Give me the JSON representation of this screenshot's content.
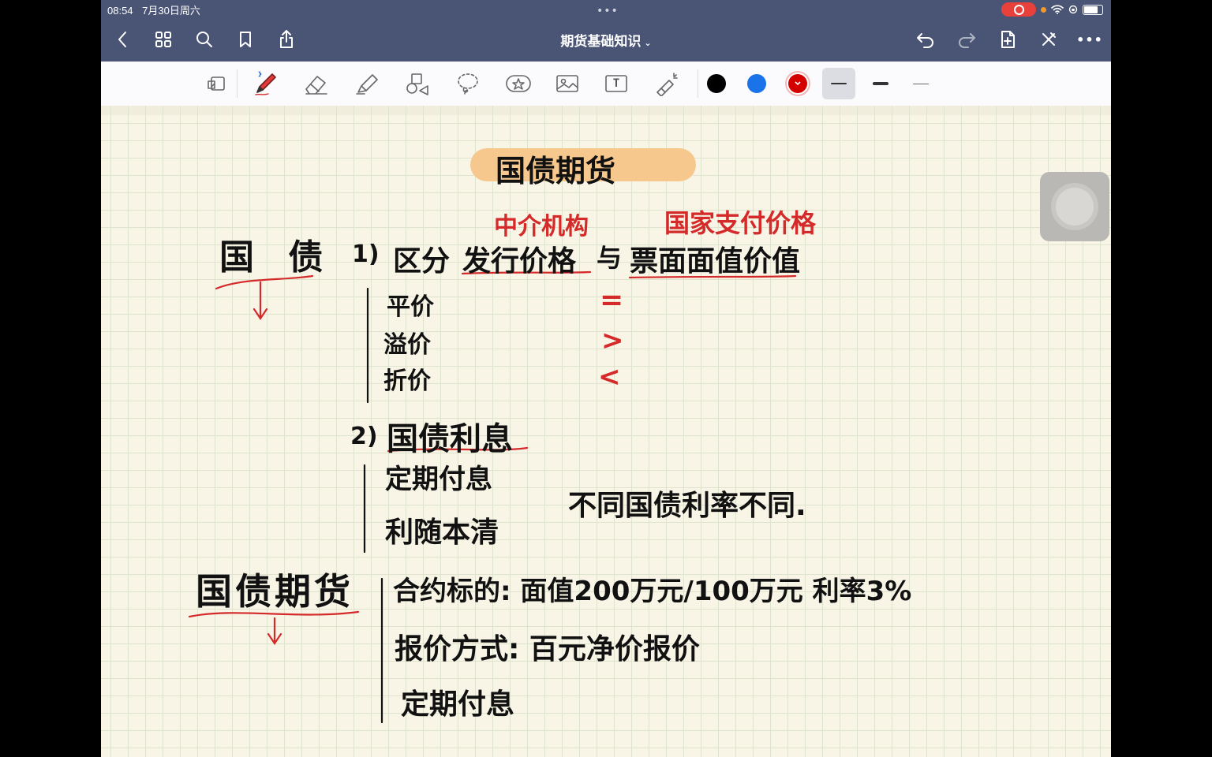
{
  "status": {
    "time": "08:54",
    "date": "7月30日周六"
  },
  "nav": {
    "title": "期货基础知识",
    "title_chevron": "⌄",
    "more_dots": "•••",
    "top_dots": "•••"
  },
  "toolbar": {
    "tools": [
      "reader-mode-icon",
      "pen-icon",
      "eraser-icon",
      "highlighter-icon",
      "shapes-icon",
      "lasso-icon",
      "sticker-icon",
      "image-icon",
      "text-icon",
      "laser-pointer-icon"
    ],
    "colors": [
      "#000000",
      "#1a73e8",
      "#d40000"
    ],
    "selected_color": "#d40000",
    "text_tool_label": "T"
  },
  "note": {
    "title": "国债期货",
    "s1_heading": "国 债",
    "s1_item1_num": "1)",
    "s1_item1_label": "区分",
    "s1_issue_price": "发行价格",
    "s1_with": "与",
    "s1_face_value": "票面面值价值",
    "s1_note_issue": "中介机构",
    "s1_note_state": "国家支付价格",
    "s1_rows": [
      {
        "label": "平价",
        "sign": "="
      },
      {
        "label": "溢价",
        "sign": ">"
      },
      {
        "label": "折价",
        "sign": "<"
      }
    ],
    "s1_item2_num": "2)",
    "s1_item2_label": "国债利息",
    "s1_interest_rows": [
      "定期付息",
      "利随本清"
    ],
    "s1_rate_note": "不同国债利率不同.",
    "s2_heading": "国债期货",
    "s2_rows": [
      "合约标的: 面值200万元/100万元  利率3%",
      "报价方式: 百元净价报价",
      "定期付息"
    ]
  }
}
